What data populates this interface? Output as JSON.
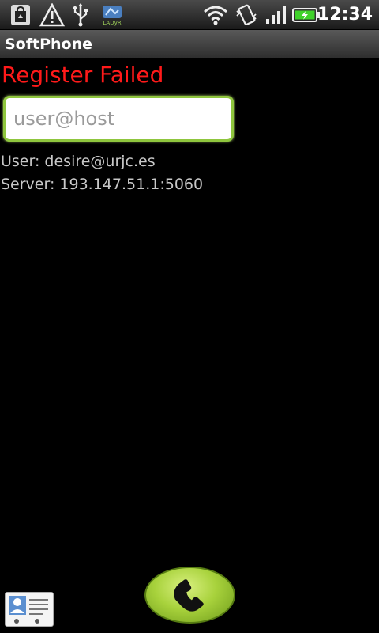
{
  "status_bar": {
    "time": "12:34",
    "badge_text": "LADyR",
    "icons": [
      "shopping-bag-icon",
      "warning-icon",
      "usb-icon",
      "app-badge-icon",
      "wifi-icon",
      "vibrate-icon",
      "signal-icon",
      "battery-icon"
    ],
    "battery_color": "#3fd22a"
  },
  "app": {
    "title": "SoftPhone",
    "status_message": "Register Failed",
    "status_color": "#ff1a1a",
    "address_input": {
      "value": "",
      "placeholder": "user@host"
    },
    "user_line": "User: desire@urjc.es",
    "server_line": "Server: 193.147.51.1:5060"
  },
  "buttons": {
    "call_icon": "phone-handset-icon",
    "contacts_icon": "contact-card-icon"
  }
}
